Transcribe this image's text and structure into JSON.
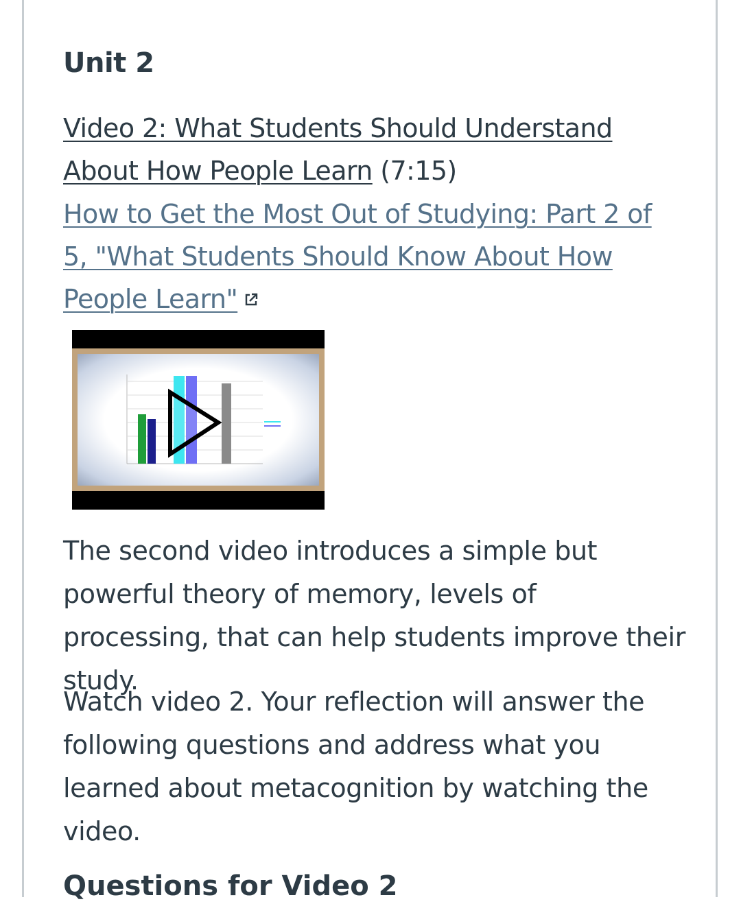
{
  "unit": {
    "title": "Unit 2"
  },
  "video": {
    "title_link": "Video 2: What Students Should Understand About How People Learn",
    "duration": "(7:15)",
    "external_link": "How to Get the Most Out of Studying: Part 2 of 5, \"What Students Should Know About How People Learn\"",
    "external_icon": "external-link-icon",
    "thumbnail_icon": "play-icon"
  },
  "paragraphs": [
    "The second video introduces a simple but powerful theory of memory, levels of processing, that can help students improve their study.",
    "Watch video 2. Your reflection will answer the following questions and address what you learned about metacognition by watching the video."
  ],
  "next_heading": "Questions for Video 2",
  "colors": {
    "text": "#2d3b45",
    "link": "#55728a",
    "border": "#c7cdd1"
  }
}
